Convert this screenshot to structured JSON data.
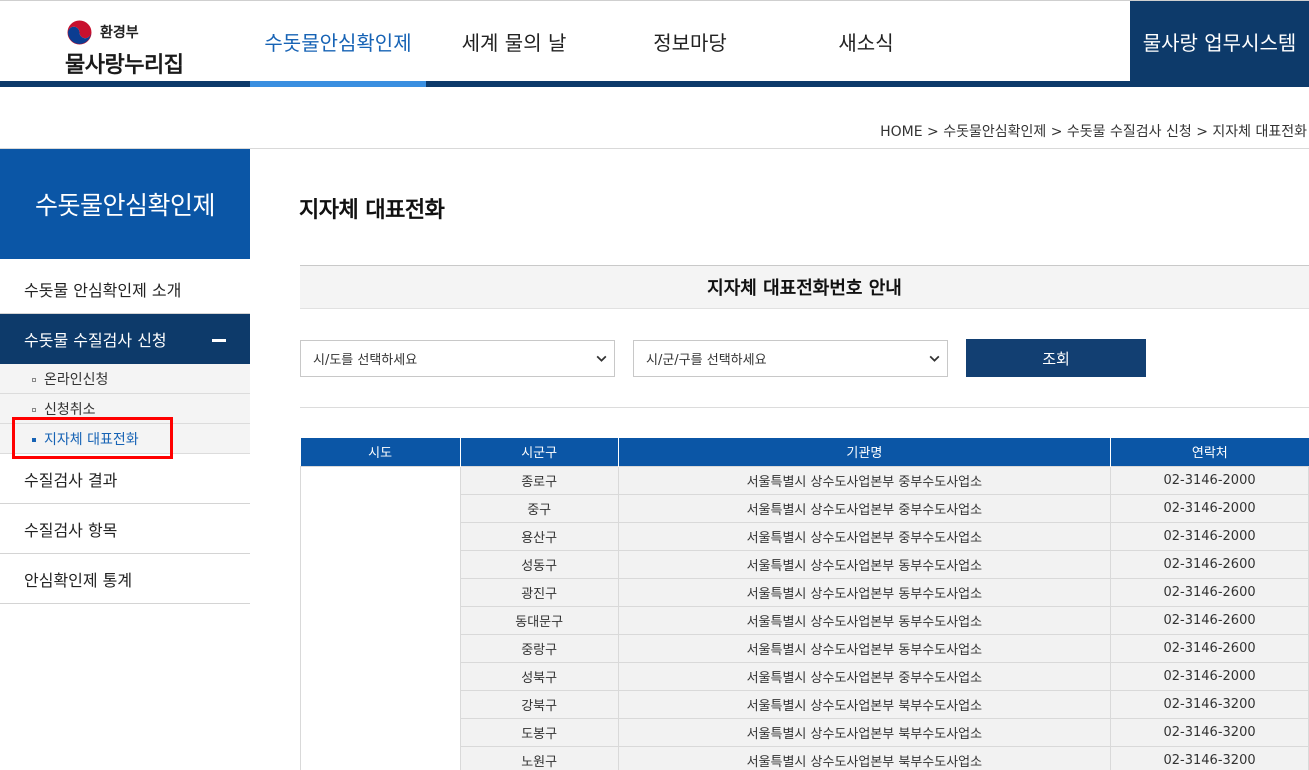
{
  "header": {
    "ministry": "환경부",
    "site_name": "물사랑누리집",
    "nav": [
      "수돗물안심확인제",
      "세계 물의 날",
      "정보마당",
      "새소식"
    ],
    "business_system": "물사랑 업무시스템"
  },
  "breadcrumb": [
    "HOME",
    "수돗물안심확인제",
    "수돗물 수질검사 신청",
    "지자체 대표전화"
  ],
  "breadcrumb_sep": ">",
  "sidebar": {
    "title": "수돗물안심확인제",
    "items": [
      "수돗물 안심확인제 소개",
      "수돗물 수질검사 신청",
      "수질검사 결과",
      "수질검사 항목",
      "안심확인제 통계"
    ],
    "sub_items": [
      "온라인신청",
      "신청취소",
      "지자체 대표전화"
    ]
  },
  "content": {
    "page_title": "지자체 대표전화",
    "info_title": "지자체 대표전화번호 안내",
    "sido_placeholder": "시/도를 선택하세요",
    "sigungu_placeholder": "시/군/구를 선택하세요",
    "search_label": "조회"
  },
  "table": {
    "headers": [
      "시도",
      "시군구",
      "기관명",
      "연락처"
    ],
    "rows": [
      [
        "종로구",
        "서울특별시 상수도사업본부 중부수도사업소",
        "02-3146-2000"
      ],
      [
        "중구",
        "서울특별시 상수도사업본부 중부수도사업소",
        "02-3146-2000"
      ],
      [
        "용산구",
        "서울특별시 상수도사업본부 중부수도사업소",
        "02-3146-2000"
      ],
      [
        "성동구",
        "서울특별시 상수도사업본부 동부수도사업소",
        "02-3146-2600"
      ],
      [
        "광진구",
        "서울특별시 상수도사업본부 동부수도사업소",
        "02-3146-2600"
      ],
      [
        "동대문구",
        "서울특별시 상수도사업본부 동부수도사업소",
        "02-3146-2600"
      ],
      [
        "중랑구",
        "서울특별시 상수도사업본부 동부수도사업소",
        "02-3146-2600"
      ],
      [
        "성북구",
        "서울특별시 상수도사업본부 중부수도사업소",
        "02-3146-2000"
      ],
      [
        "강북구",
        "서울특별시 상수도사업본부 북부수도사업소",
        "02-3146-3200"
      ],
      [
        "도봉구",
        "서울특별시 상수도사업본부 북부수도사업소",
        "02-3146-3200"
      ],
      [
        "노원구",
        "서울특별시 상수도사업본부 북부수도사업소",
        "02-3146-3200"
      ]
    ]
  },
  "colors": {
    "primary_blue": "#0b56a6",
    "dark_navy": "#0d3a6a",
    "active_link": "#1763b5",
    "highlight_red": "#ff0000"
  }
}
